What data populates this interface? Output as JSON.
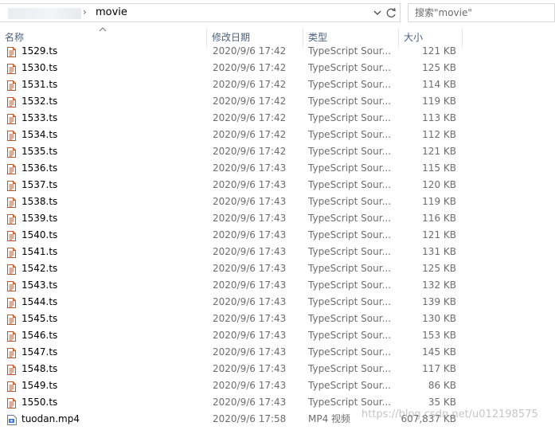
{
  "address_bar": {
    "separator": "›",
    "current_folder": "movie"
  },
  "search": {
    "placeholder": "搜索\"movie\""
  },
  "columns": {
    "name": "名称",
    "date": "修改日期",
    "type": "类型",
    "size": "大小"
  },
  "sort": {
    "column": "name",
    "direction": "ascending"
  },
  "files": [
    {
      "name": "1529.ts",
      "date": "2020/9/6 17:42",
      "type": "TypeScript Sour...",
      "size": "121 KB",
      "icon": "text-file-icon"
    },
    {
      "name": "1530.ts",
      "date": "2020/9/6 17:42",
      "type": "TypeScript Sour...",
      "size": "125 KB",
      "icon": "text-file-icon"
    },
    {
      "name": "1531.ts",
      "date": "2020/9/6 17:42",
      "type": "TypeScript Sour...",
      "size": "114 KB",
      "icon": "text-file-icon"
    },
    {
      "name": "1532.ts",
      "date": "2020/9/6 17:42",
      "type": "TypeScript Sour...",
      "size": "119 KB",
      "icon": "text-file-icon"
    },
    {
      "name": "1533.ts",
      "date": "2020/9/6 17:42",
      "type": "TypeScript Sour...",
      "size": "113 KB",
      "icon": "text-file-icon"
    },
    {
      "name": "1534.ts",
      "date": "2020/9/6 17:42",
      "type": "TypeScript Sour...",
      "size": "112 KB",
      "icon": "text-file-icon"
    },
    {
      "name": "1535.ts",
      "date": "2020/9/6 17:42",
      "type": "TypeScript Sour...",
      "size": "121 KB",
      "icon": "text-file-icon"
    },
    {
      "name": "1536.ts",
      "date": "2020/9/6 17:43",
      "type": "TypeScript Sour...",
      "size": "115 KB",
      "icon": "text-file-icon"
    },
    {
      "name": "1537.ts",
      "date": "2020/9/6 17:43",
      "type": "TypeScript Sour...",
      "size": "120 KB",
      "icon": "text-file-icon"
    },
    {
      "name": "1538.ts",
      "date": "2020/9/6 17:43",
      "type": "TypeScript Sour...",
      "size": "119 KB",
      "icon": "text-file-icon"
    },
    {
      "name": "1539.ts",
      "date": "2020/9/6 17:43",
      "type": "TypeScript Sour...",
      "size": "116 KB",
      "icon": "text-file-icon"
    },
    {
      "name": "1540.ts",
      "date": "2020/9/6 17:43",
      "type": "TypeScript Sour...",
      "size": "121 KB",
      "icon": "text-file-icon"
    },
    {
      "name": "1541.ts",
      "date": "2020/9/6 17:43",
      "type": "TypeScript Sour...",
      "size": "131 KB",
      "icon": "text-file-icon"
    },
    {
      "name": "1542.ts",
      "date": "2020/9/6 17:43",
      "type": "TypeScript Sour...",
      "size": "125 KB",
      "icon": "text-file-icon"
    },
    {
      "name": "1543.ts",
      "date": "2020/9/6 17:43",
      "type": "TypeScript Sour...",
      "size": "132 KB",
      "icon": "text-file-icon"
    },
    {
      "name": "1544.ts",
      "date": "2020/9/6 17:43",
      "type": "TypeScript Sour...",
      "size": "139 KB",
      "icon": "text-file-icon"
    },
    {
      "name": "1545.ts",
      "date": "2020/9/6 17:43",
      "type": "TypeScript Sour...",
      "size": "130 KB",
      "icon": "text-file-icon"
    },
    {
      "name": "1546.ts",
      "date": "2020/9/6 17:43",
      "type": "TypeScript Sour...",
      "size": "153 KB",
      "icon": "text-file-icon"
    },
    {
      "name": "1547.ts",
      "date": "2020/9/6 17:43",
      "type": "TypeScript Sour...",
      "size": "145 KB",
      "icon": "text-file-icon"
    },
    {
      "name": "1548.ts",
      "date": "2020/9/6 17:43",
      "type": "TypeScript Sour...",
      "size": "117 KB",
      "icon": "text-file-icon"
    },
    {
      "name": "1549.ts",
      "date": "2020/9/6 17:43",
      "type": "TypeScript Sour...",
      "size": "86 KB",
      "icon": "text-file-icon"
    },
    {
      "name": "1550.ts",
      "date": "2020/9/6 17:43",
      "type": "TypeScript Sour...",
      "size": "35 KB",
      "icon": "text-file-icon"
    },
    {
      "name": "tuodan.mp4",
      "date": "2020/9/6 17:58",
      "type": "MP4 视频",
      "size": "607,837 KB",
      "icon": "video-file-icon"
    }
  ],
  "watermark": "https://blog.csdn.net/u012198575",
  "colors": {
    "header_text": "#4c607a",
    "secondary_text": "#6d6d6d",
    "ts_icon": "#b4582d",
    "border": "#d9d9d9"
  }
}
